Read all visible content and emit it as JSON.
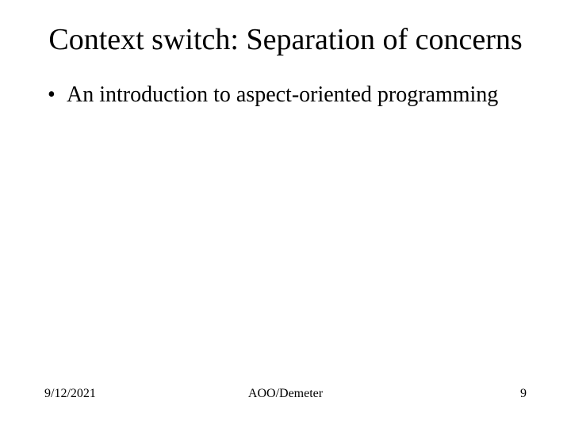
{
  "slide": {
    "title": "Context switch: Separation of concerns",
    "bullets": [
      "An introduction to aspect-oriented programming"
    ]
  },
  "footer": {
    "date": "9/12/2021",
    "center": "AOO/Demeter",
    "page": "9"
  }
}
